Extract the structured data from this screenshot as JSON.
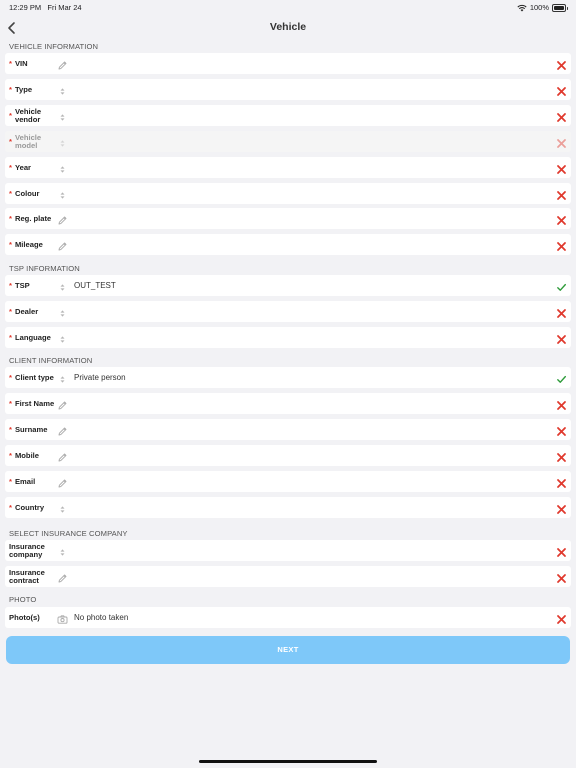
{
  "status_bar": {
    "time": "12:29 PM",
    "date": "Fri Mar 24",
    "battery": "100%"
  },
  "nav": {
    "title": "Vehicle"
  },
  "colors": {
    "accent": "#7ec8f9",
    "error": "#e0392d",
    "ok": "#2e9b3a"
  },
  "sections": {
    "vehicle": "VEHICLE INFORMATION",
    "tsp": "TSP INFORMATION",
    "client": "CLIENT INFORMATION",
    "insurance": "SELECT INSURANCE COMPANY",
    "photo": "PHOTO"
  },
  "rows": [
    {
      "label": "VIN",
      "required": true,
      "icon": "pencil-icon",
      "value": "",
      "status": "error"
    },
    {
      "label": "Type",
      "required": true,
      "icon": "stepper-icon",
      "value": "",
      "status": "error"
    },
    {
      "label": "Vehicle vendor",
      "required": true,
      "icon": "stepper-icon",
      "value": "",
      "status": "error"
    },
    {
      "label": "Vehicle model",
      "required": true,
      "icon": "stepper-icon",
      "value": "",
      "status": "error",
      "disabled": true
    },
    {
      "label": "Year",
      "required": true,
      "icon": "stepper-icon",
      "value": "",
      "status": "error"
    },
    {
      "label": "Colour",
      "required": true,
      "icon": "stepper-icon",
      "value": "",
      "status": "error"
    },
    {
      "label": "Reg. plate",
      "required": true,
      "icon": "pencil-icon",
      "value": "",
      "status": "error"
    },
    {
      "label": "Mileage",
      "required": true,
      "icon": "pencil-icon",
      "value": "",
      "status": "error"
    },
    {
      "label": "TSP",
      "required": true,
      "icon": "stepper-icon",
      "value": "OUT_TEST",
      "status": "ok"
    },
    {
      "label": "Dealer",
      "required": true,
      "icon": "stepper-icon",
      "value": "",
      "status": "error"
    },
    {
      "label": "Language",
      "required": true,
      "icon": "stepper-icon",
      "value": "",
      "status": "error"
    },
    {
      "label": "Client type",
      "required": true,
      "icon": "stepper-icon",
      "value": "Private person",
      "status": "ok"
    },
    {
      "label": "First Name",
      "required": true,
      "icon": "pencil-icon",
      "value": "",
      "status": "error"
    },
    {
      "label": "Surname",
      "required": true,
      "icon": "pencil-icon",
      "value": "",
      "status": "error"
    },
    {
      "label": "Mobile",
      "required": true,
      "icon": "pencil-icon",
      "value": "",
      "status": "error"
    },
    {
      "label": "Email",
      "required": true,
      "icon": "pencil-icon",
      "value": "",
      "status": "error"
    },
    {
      "label": "Country",
      "required": true,
      "icon": "stepper-icon",
      "value": "",
      "status": "error"
    },
    {
      "label": "Insurance company",
      "required": false,
      "icon": "stepper-icon",
      "value": "",
      "status": "error"
    },
    {
      "label": "Insurance contract",
      "required": false,
      "icon": "pencil-icon",
      "value": "",
      "status": "error"
    },
    {
      "label": "Photo(s)",
      "required": false,
      "icon": "camera-icon",
      "value": "No photo taken",
      "status": "error"
    }
  ],
  "next_button": "NEXT"
}
